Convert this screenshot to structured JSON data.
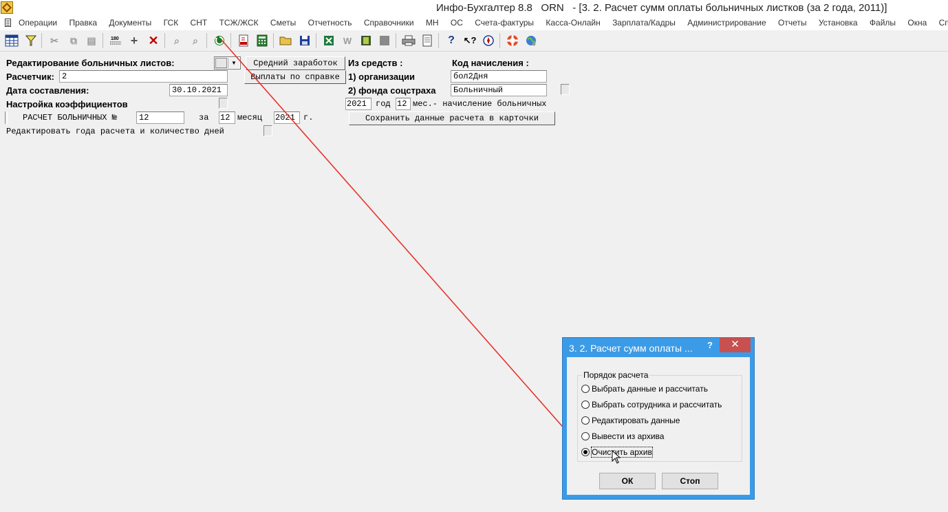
{
  "window": {
    "title": "Инфо-Бухгалтер 8.8   ORN   - [3. 2. Расчет сумм оплаты больничных листков (за 2 года, 2011)]"
  },
  "menu": [
    "Операции",
    "Правка",
    "Документы",
    "ГСК",
    "СНТ",
    "ТСЖ/ЖСК",
    "Сметы",
    "Отчетность",
    "Справочники",
    "МН",
    "ОС",
    "Счета-фактуры",
    "Касса-Онлайн",
    "Зарплата/Кадры",
    "Администрирование",
    "Отчеты",
    "Установка",
    "Файлы",
    "Окна",
    "Справка"
  ],
  "toolbar": {
    "icons": [
      "table-icon",
      "filter-icon",
      "cut-icon",
      "copy-icon",
      "paste-icon",
      "number-icon",
      "add-icon",
      "delete-icon",
      "find-icon",
      "find-next-icon",
      "refresh-icon",
      "pdf-icon",
      "calculator-icon",
      "open-folder-icon",
      "save-icon",
      "excel-icon",
      "word-icon",
      "archive-icon",
      "blank-icon",
      "print-icon",
      "preview-icon",
      "help-icon",
      "context-help-icon",
      "compass-icon",
      "lifebuoy-icon",
      "globe-icon"
    ]
  },
  "form": {
    "edit_label": "Редактирование больничных листов:",
    "avg_earnings_button": "Средний заработок",
    "certificate_button": "Выплаты по справке",
    "calculator_label": "Расчетчик:",
    "calculator_value": "2",
    "date_label": "Дата составления:",
    "date_value": "30.10.2021",
    "coeff_label": "Настройка коэффициентов",
    "sick_calc_label": "РАСЧЕТ БОЛЬНИЧНЫХ №",
    "sick_calc_number": "12",
    "for_label": "за",
    "month_value": "12",
    "month_label": "месяц",
    "year_value": "2021",
    "year_suffix": "г.",
    "edit_years_label": "Редактировать года расчета и количество дней",
    "from_funds_label": "Из средств :",
    "org_label": "1) организации",
    "fund_label": "2) фонда соцстраха",
    "accrual_code_label": "Код начисления :",
    "org_code": "бол2Дня",
    "fund_code": "Больничный",
    "period_year": "2021",
    "period_year_label": "год",
    "period_months": "12",
    "period_months_label": "мес.- начисление больничных",
    "save_button": "Сохранить данные расчета в карточки"
  },
  "dialog": {
    "title": "3. 2. Расчет сумм оплаты ...",
    "help": "?",
    "close": "✕",
    "group_label": "Порядок расчета",
    "options": [
      {
        "label": "Выбрать данные и рассчитать",
        "selected": false
      },
      {
        "label": "Выбрать сотрудника и рассчитать",
        "selected": false
      },
      {
        "label": "Редактировать данные",
        "selected": false
      },
      {
        "label": "Вывести из архива",
        "selected": false
      },
      {
        "label": "Очистить архив",
        "selected": true
      }
    ],
    "ok_button": "ОК",
    "stop_button": "Стоп"
  },
  "colors": {
    "dialog_border": "#3c9be6",
    "close_button": "#c75050",
    "annotation_arrow": "#e8322b"
  }
}
